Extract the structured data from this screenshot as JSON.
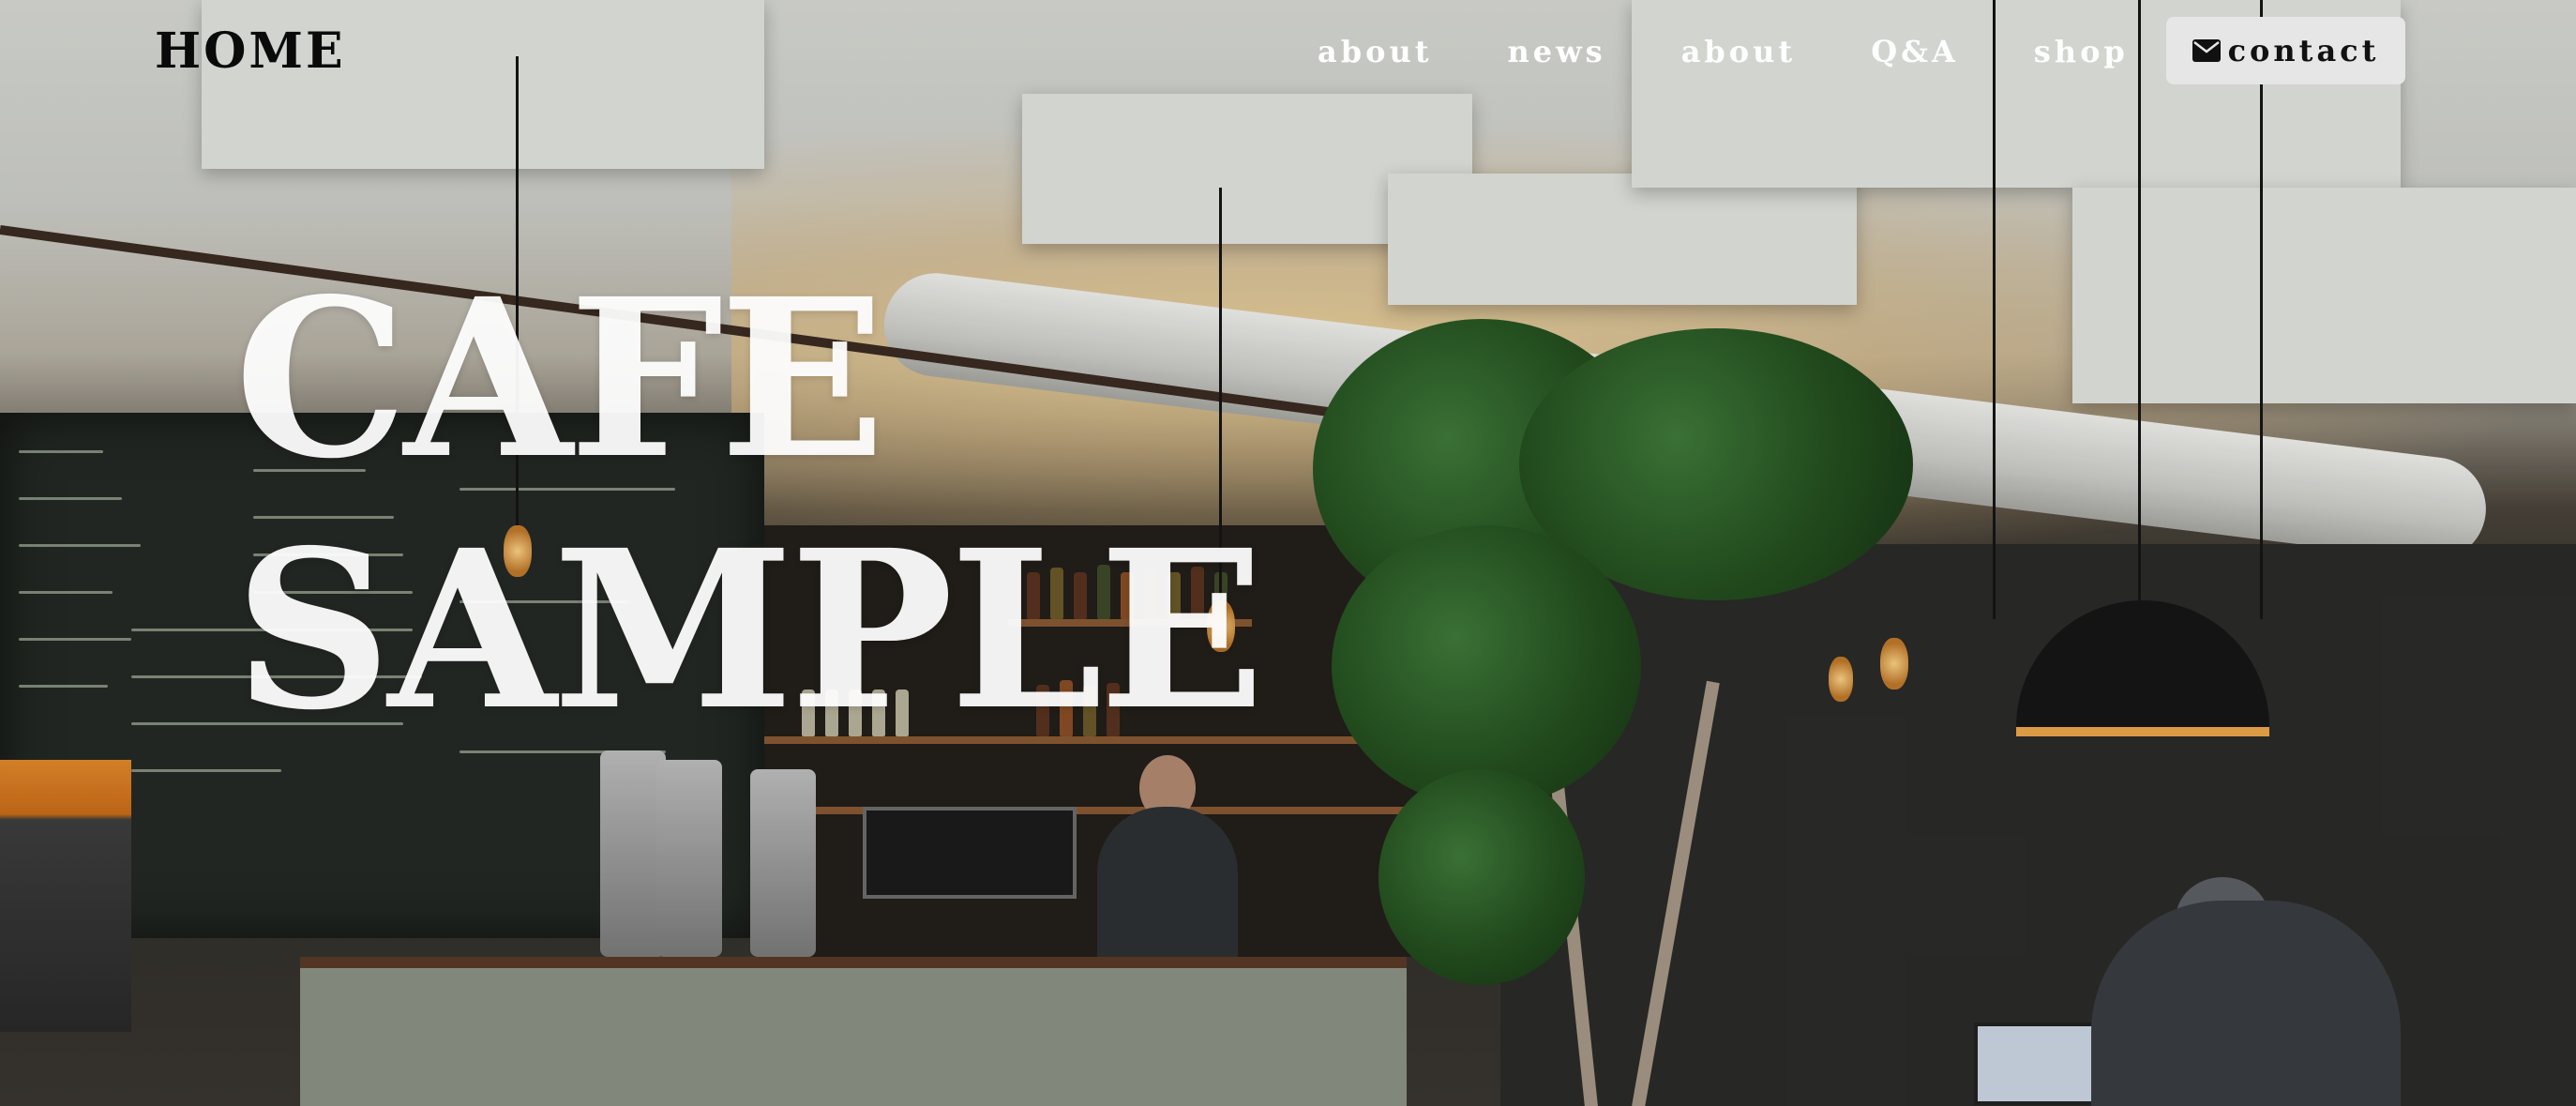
{
  "header": {
    "logo": "HOME"
  },
  "nav": {
    "items": [
      {
        "label": "about"
      },
      {
        "label": "news"
      },
      {
        "label": "about"
      },
      {
        "label": "Q&A"
      },
      {
        "label": "shop"
      }
    ],
    "contact": {
      "label": "contact",
      "icon": "envelope-icon"
    }
  },
  "hero": {
    "title_line1": "CAFE",
    "title_line2": "SAMPLE"
  },
  "colors": {
    "logo_text": "#0a0a0a",
    "nav_text": "#ffffff",
    "contact_button_bg": "#e6e6e6",
    "hero_text": "#ffffff"
  }
}
